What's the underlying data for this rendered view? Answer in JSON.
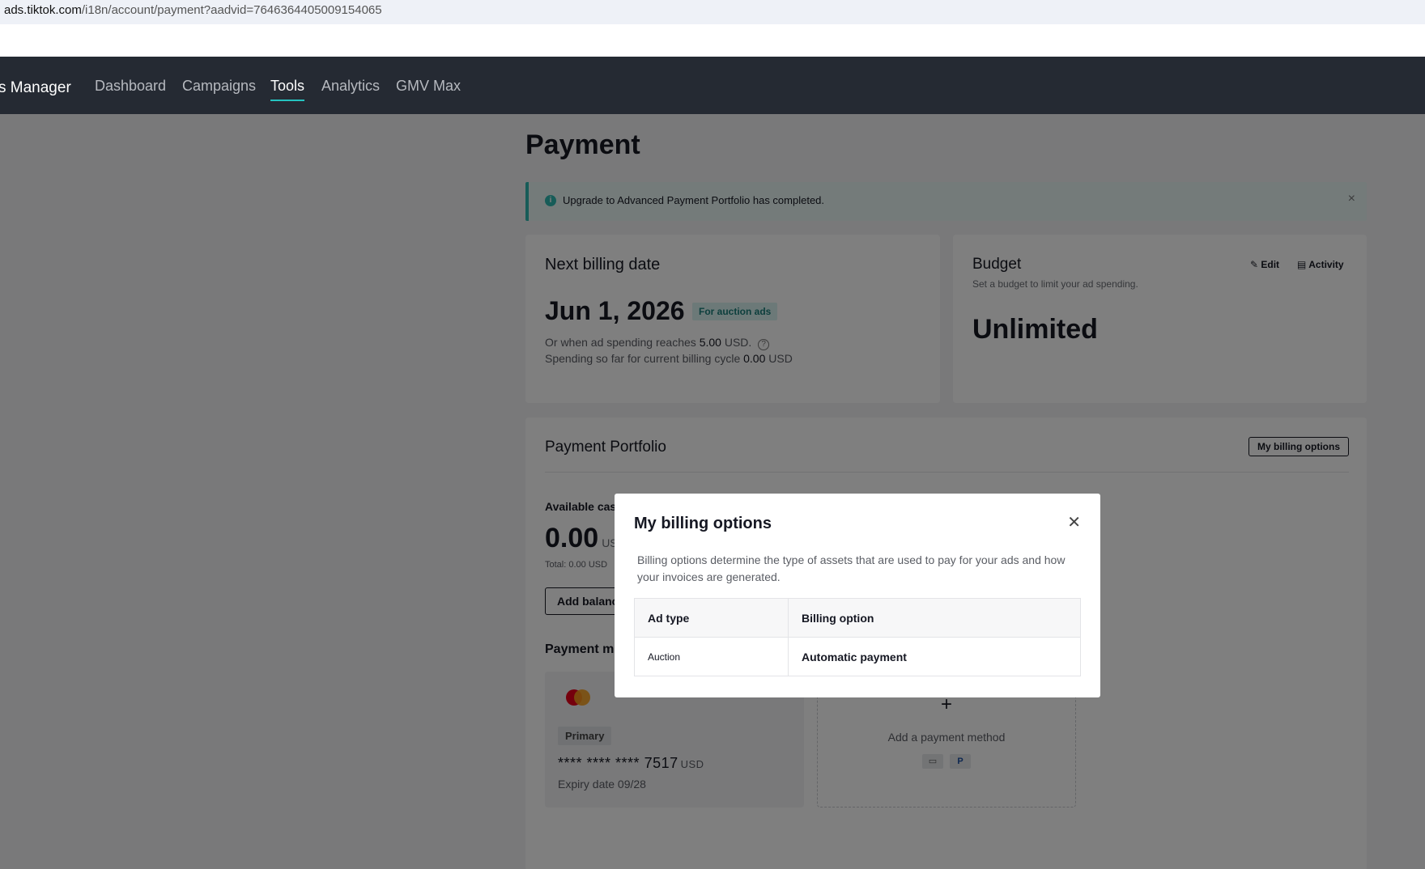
{
  "browser": {
    "url_host": "ads.tiktok.com",
    "url_path": "/i18n/account/payment?aadvid=7646364405009154065"
  },
  "nav": {
    "brand": "s Manager",
    "items": [
      "Dashboard",
      "Campaigns",
      "Tools",
      "Analytics",
      "GMV Max"
    ],
    "active": "Tools"
  },
  "page": {
    "title": "Payment",
    "alert": "Upgrade to Advanced Payment Portfolio has completed."
  },
  "billing": {
    "heading": "Next billing date",
    "date": "Jun 1, 2026",
    "tag": "For auction ads",
    "line1_prefix": "Or when ad spending reaches",
    "line1_amount": "5.00",
    "line1_unit": "USD.",
    "line2_prefix": "Spending so far for current billing cycle",
    "line2_amount": "0.00",
    "line2_unit": "USD"
  },
  "budget": {
    "heading": "Budget",
    "subtitle": "Set a budget to limit your ad spending.",
    "edit_label": "Edit",
    "activity_label": "Activity",
    "value": "Unlimited"
  },
  "portfolio": {
    "heading": "Payment Portfolio",
    "billing_options_button": "My billing options",
    "available_label": "Available cas",
    "amount": "0.00",
    "amount_unit": "US",
    "total_prefix": "Total:",
    "total_value": "0.00 USD",
    "add_balance": "Add balanc",
    "payment_methods_label": "Payment m"
  },
  "card": {
    "badge": "Primary",
    "mask": "**** **** ****",
    "last4": "7517",
    "currency": "USD",
    "expiry": "Expiry date 09/28"
  },
  "add_method": {
    "plus": "+",
    "label": "Add a payment method"
  },
  "modal": {
    "title": "My billing options",
    "description": "Billing options determine the type of assets that are used to pay for your ads and how your invoices are generated.",
    "columns": [
      "Ad type",
      "Billing option"
    ],
    "rows": [
      [
        "Auction",
        "Automatic payment"
      ]
    ]
  }
}
